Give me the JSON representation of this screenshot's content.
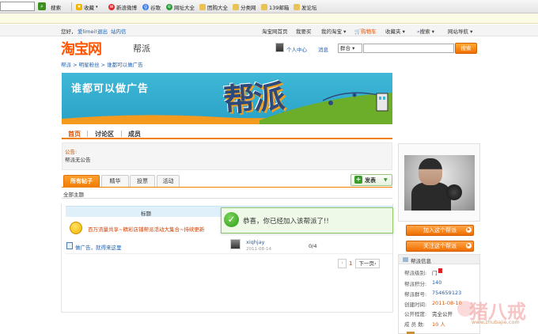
{
  "browser": {
    "search_label": "搜索",
    "toolbar_items": [
      {
        "label": "收藏",
        "icon": "star-icon"
      },
      {
        "label": "新浪微博",
        "icon": "weibo-icon"
      },
      {
        "label": "谷歌",
        "icon": "google-icon"
      },
      {
        "label": "网址大全",
        "icon": "globe-icon"
      },
      {
        "label": "团购大全",
        "icon": "folder-icon"
      },
      {
        "label": "分类网",
        "icon": "folder-icon"
      },
      {
        "label": "139邮箱",
        "icon": "folder-icon"
      },
      {
        "label": "发论坛",
        "icon": "folder-icon"
      }
    ]
  },
  "topnav": {
    "greeting": "您好，",
    "username": "爱limei!",
    "logout": "退出",
    "inbox": "站内信",
    "links": [
      "淘宝网首页",
      "我要买",
      "我的淘宝 ▾",
      "购物车",
      "收藏夹 ▾",
      "搜索 ▾",
      "网站导航 ▾"
    ]
  },
  "header": {
    "logo": "淘宝网",
    "section": "帮派",
    "personal_center": "个人中心",
    "messages": "消息",
    "scope_select": "群合 ▾",
    "search_placeholder": "",
    "search_button": "搜索"
  },
  "breadcrumb": "帮派 > 明星粉丝 > 谁都可以做广告",
  "banner": {
    "slogan": "谁都可以做广告",
    "big_word": "帮派"
  },
  "group_nav": [
    "首页",
    "讨论区",
    "成员"
  ],
  "announcement": {
    "label": "公告:",
    "text": "帮派无公告"
  },
  "tabs": [
    "所有帖子",
    "精华",
    "投票",
    "活动"
  ],
  "post_button": {
    "label": "发表"
  },
  "subtab": "全部主题",
  "table": {
    "header_title": "标题",
    "sticky_title": "百万流量共享~精彩店铺帮派活动大集合~持续更新",
    "rows": [
      {
        "title": "做广告，就得来这里",
        "author": "xiqhjay",
        "date": "2011-08-14",
        "count": "0/4"
      }
    ]
  },
  "pagination": {
    "prev": "‹",
    "current": "1",
    "next": "下一页›"
  },
  "toast": {
    "message": "恭喜，你已经加入该帮派了!!"
  },
  "sidebar": {
    "join_button": "加入这个帮派",
    "follow_button": "关注这个帮派",
    "info_title": "帮派信息",
    "info": [
      {
        "label": "帮派级别:",
        "value": "门"
      },
      {
        "label": "帮派积分:",
        "value": "140"
      },
      {
        "label": "帮派群号:",
        "value": "754659123"
      },
      {
        "label": "创建时间:",
        "value": "2011-08-10"
      },
      {
        "label": "公开程度:",
        "value": "完全公开"
      },
      {
        "label": "成 员 数:",
        "value": "10 人"
      }
    ]
  },
  "watermark": {
    "text": "猪八戒",
    "url": "www.zhubajie.com"
  },
  "colors": {
    "accent": "#f07a00",
    "link": "#2060b0",
    "banner": "#2aa2c8",
    "success": "#2f9a1b"
  }
}
